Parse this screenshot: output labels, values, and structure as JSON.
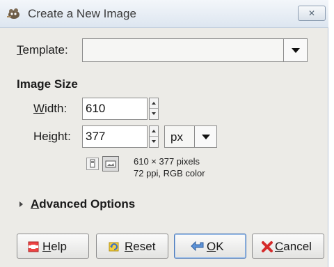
{
  "window": {
    "title": "Create a New Image",
    "close_label": "✕"
  },
  "template": {
    "label_prefix": "",
    "label_mnemonic": "T",
    "label_rest": "emplate:",
    "value": ""
  },
  "image_size": {
    "section_title": "Image Size",
    "width_label_mnemonic": "W",
    "width_label_rest": "idth:",
    "width_value": "610",
    "height_label_pre": "He",
    "height_label_mnemonic": "i",
    "height_label_rest": "ght:",
    "height_value": "377",
    "unit": "px",
    "info_line1": "610 × 377 pixels",
    "info_line2": "72 ppi, RGB color"
  },
  "advanced": {
    "label_mnemonic": "A",
    "label_rest": "dvanced Options"
  },
  "buttons": {
    "help": {
      "mnemonic": "H",
      "rest": "elp"
    },
    "reset": {
      "mnemonic": "R",
      "rest": "eset"
    },
    "ok": {
      "mnemonic": "O",
      "rest": "K"
    },
    "cancel": {
      "mnemonic": "C",
      "rest": "ancel"
    }
  },
  "icons": {
    "title": "wilber-icon",
    "help": "help-lifebuoy-icon",
    "reset": "reset-icon",
    "ok": "ok-arrow-icon",
    "cancel": "cancel-x-icon"
  }
}
